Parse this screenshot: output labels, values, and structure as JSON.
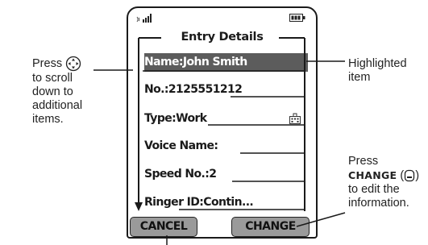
{
  "screen": {
    "title": "Entry Details",
    "rows": [
      {
        "label": "Name:",
        "value": "John Smith",
        "highlighted": true
      },
      {
        "label": "No.:",
        "value": "2125551212"
      },
      {
        "label": "Type:",
        "value": "Work"
      },
      {
        "label": "Voice Name:",
        "value": ""
      },
      {
        "label": "Speed No.:",
        "value": "2"
      },
      {
        "label": "Ringer ID:",
        "value": "Contin..."
      }
    ],
    "softkeys": {
      "left": "CANCEL",
      "right": "CHANGE"
    }
  },
  "callouts": {
    "left": {
      "press": "Press",
      "rest": "to scroll down to additional items."
    },
    "right_top": "Highlighted item",
    "right_bottom": {
      "press": "Press",
      "keyword": "CHANGE",
      "rest": "to edit the information."
    }
  },
  "icons": {
    "signal": "signal-strength-icon",
    "battery": "battery-icon",
    "work": "office-building-icon",
    "nav_key": "navigation-key-icon",
    "soft_key": "right-soft-key-icon"
  },
  "colors": {
    "highlight": "#5c5c5c",
    "softkey": "#9a9a9a",
    "line": "#1a1a1a"
  }
}
